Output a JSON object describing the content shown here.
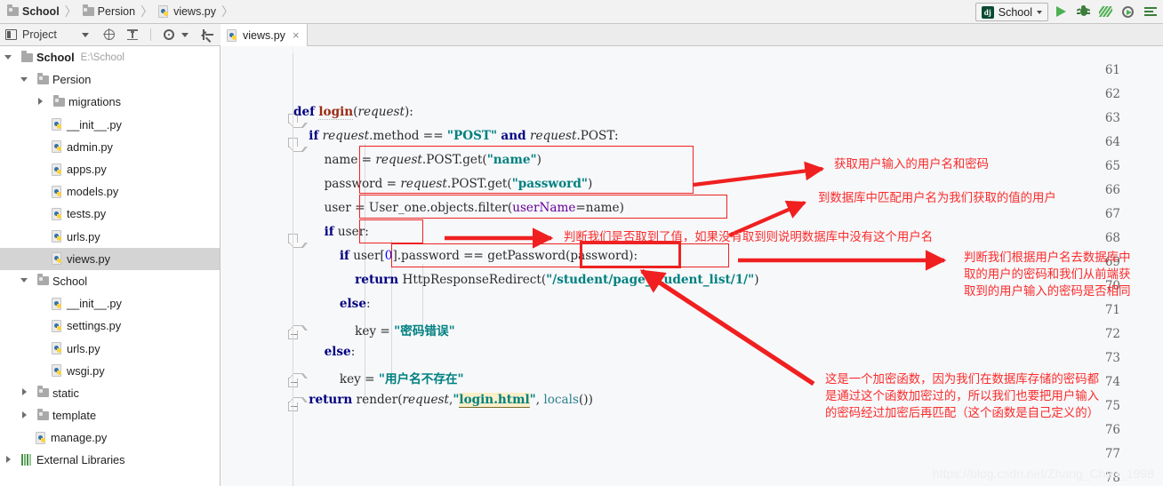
{
  "breadcrumb": {
    "items": [
      {
        "label": "School",
        "icon": "folder-icon",
        "bold": true
      },
      {
        "label": "Persion",
        "icon": "folder-icon",
        "bold": false
      },
      {
        "label": "views.py",
        "icon": "python-file-icon",
        "bold": false
      }
    ],
    "separator": "〉"
  },
  "run_toolbar": {
    "config_name": "School",
    "config_icon": "django-icon",
    "config_badge": "dj",
    "buttons": [
      {
        "name": "run-button",
        "icon": "run-icon"
      },
      {
        "name": "debug-button",
        "icon": "bug-icon"
      },
      {
        "name": "coverage-button",
        "icon": "coverage-icon"
      },
      {
        "name": "profile-button",
        "icon": "profile-icon"
      },
      {
        "name": "run-anything-button",
        "icon": "lines-run-icon"
      }
    ]
  },
  "project_panel": {
    "title": "Project",
    "toolbar_icons": [
      "window-mode-icon",
      "chevron-down-icon",
      "locate-icon",
      "collapse-all-icon",
      "settings-gear-icon",
      "hide-icon"
    ],
    "tree": [
      {
        "label": "School",
        "path": "E:\\School",
        "icon": "folder-icon",
        "indent": 0,
        "arrow": "down",
        "bold": true,
        "selected": false
      },
      {
        "label": "Persion",
        "path": "",
        "icon": "folder-icon",
        "indent": 1,
        "arrow": "down",
        "bold": false,
        "selected": false
      },
      {
        "label": "migrations",
        "path": "",
        "icon": "folder-icon",
        "indent": 2,
        "arrow": "right",
        "bold": false,
        "selected": false
      },
      {
        "label": "__init__.py",
        "path": "",
        "icon": "python-file-icon",
        "indent": 3,
        "arrow": "none",
        "bold": false,
        "selected": false
      },
      {
        "label": "admin.py",
        "path": "",
        "icon": "python-file-icon",
        "indent": 3,
        "arrow": "none",
        "bold": false,
        "selected": false
      },
      {
        "label": "apps.py",
        "path": "",
        "icon": "python-file-icon",
        "indent": 3,
        "arrow": "none",
        "bold": false,
        "selected": false
      },
      {
        "label": "models.py",
        "path": "",
        "icon": "python-file-icon",
        "indent": 3,
        "arrow": "none",
        "bold": false,
        "selected": false
      },
      {
        "label": "tests.py",
        "path": "",
        "icon": "python-file-icon",
        "indent": 3,
        "arrow": "none",
        "bold": false,
        "selected": false
      },
      {
        "label": "urls.py",
        "path": "",
        "icon": "python-file-icon",
        "indent": 3,
        "arrow": "none",
        "bold": false,
        "selected": false
      },
      {
        "label": "views.py",
        "path": "",
        "icon": "python-file-icon",
        "indent": 3,
        "arrow": "none",
        "bold": false,
        "selected": true
      },
      {
        "label": "School",
        "path": "",
        "icon": "folder-icon",
        "indent": 1,
        "arrow": "down",
        "bold": false,
        "selected": false
      },
      {
        "label": "__init__.py",
        "path": "",
        "icon": "python-file-icon",
        "indent": 3,
        "arrow": "none",
        "bold": false,
        "selected": false
      },
      {
        "label": "settings.py",
        "path": "",
        "icon": "python-file-icon",
        "indent": 3,
        "arrow": "none",
        "bold": false,
        "selected": false
      },
      {
        "label": "urls.py",
        "path": "",
        "icon": "python-file-icon",
        "indent": 3,
        "arrow": "none",
        "bold": false,
        "selected": false
      },
      {
        "label": "wsgi.py",
        "path": "",
        "icon": "python-file-icon",
        "indent": 3,
        "arrow": "none",
        "bold": false,
        "selected": false
      },
      {
        "label": "static",
        "path": "",
        "icon": "folder-icon",
        "indent": 1,
        "arrow": "right",
        "bold": false,
        "selected": false
      },
      {
        "label": "template",
        "path": "",
        "icon": "folder-icon",
        "indent": 1,
        "arrow": "right",
        "bold": false,
        "selected": false
      },
      {
        "label": "manage.py",
        "path": "",
        "icon": "python-file-icon",
        "indent": 2,
        "arrow": "none",
        "bold": false,
        "selected": false
      },
      {
        "label": "External Libraries",
        "path": "",
        "icon": "library-icon",
        "indent": 0,
        "arrow": "right",
        "bold": false,
        "selected": false
      }
    ]
  },
  "editor": {
    "tabs": [
      {
        "label": "views.py",
        "icon": "python-file-icon",
        "close": "×",
        "active": true
      }
    ],
    "first_line": 61,
    "lines": [
      {
        "n": 61,
        "text": ""
      },
      {
        "n": 62,
        "text": ""
      },
      {
        "n": 63,
        "text": "def login(request):"
      },
      {
        "n": 64,
        "text": "    if request.method == \"POST\" and request.POST:"
      },
      {
        "n": 65,
        "text": "        name = request.POST.get(\"name\")"
      },
      {
        "n": 66,
        "text": "        password = request.POST.get(\"password\")"
      },
      {
        "n": 67,
        "text": "        user = User_one.objects.filter(userName=name)"
      },
      {
        "n": 68,
        "text": "        if user:"
      },
      {
        "n": 69,
        "text": "            if user[0].password == getPassword(password):"
      },
      {
        "n": 70,
        "text": "                return HttpResponseRedirect(\"/student/page_student_list/1/\")"
      },
      {
        "n": 71,
        "text": "            else:"
      },
      {
        "n": 72,
        "text": "                key = \"密码错误\""
      },
      {
        "n": 73,
        "text": "        else:"
      },
      {
        "n": 74,
        "text": "            key = \"用户名不存在\""
      },
      {
        "n": 75,
        "text": "    return render(request,\"login.html\", locals())"
      },
      {
        "n": 76,
        "text": ""
      },
      {
        "n": 77,
        "text": ""
      },
      {
        "n": 78,
        "text": ""
      }
    ]
  },
  "annotations": [
    {
      "id": "a1",
      "text": "获取用户输入的用户名和密码",
      "target_lines": "65-66"
    },
    {
      "id": "a2",
      "text": "到数据库中匹配用户名为我们获取的值的用户",
      "target_lines": "67"
    },
    {
      "id": "a3",
      "text": "判断我们是否取到了值，如果没有取到则说明数据库中没有这个用户名",
      "target_lines": "68"
    },
    {
      "id": "a4",
      "text": "判断我们根据用户名去数据库中\n取的用户的密码和我们从前端获\n取到的用户输入的密码是否相同",
      "target_lines": "69"
    },
    {
      "id": "a5",
      "text": "这是一个加密函数，因为我们在数据库存储的密码都\n是通过这个函数加密过的，所以我们也要把用户输入\n的密码经过加密后再匹配（这个函数是自己定义的）",
      "target_lines": "69-getPassword"
    }
  ],
  "watermark": "https://blog.csdn.net/Zhang_Chao_1998",
  "colors": {
    "annotation_red": "#fa2b2b",
    "box_red": "#ee2222",
    "keyword_navy": "#000080",
    "string_teal": "#008080",
    "function_brown": "#9b2a14",
    "selection_gray": "#d4d4d4",
    "editor_bg": "#f7f8fa"
  }
}
